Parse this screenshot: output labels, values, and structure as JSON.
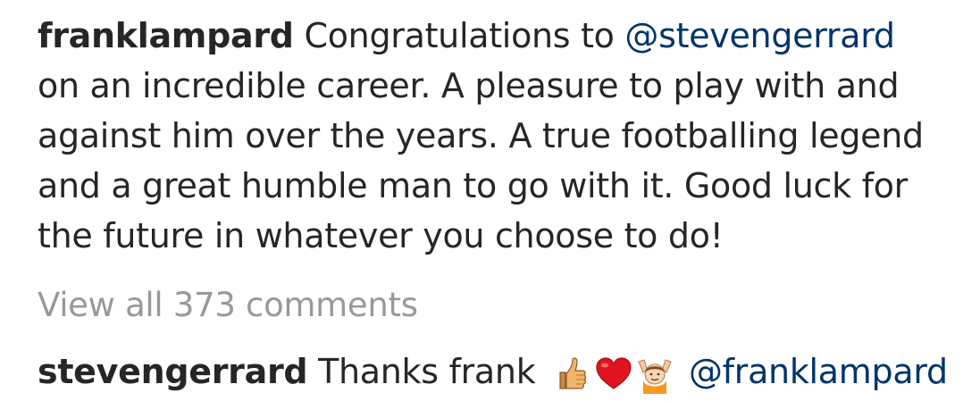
{
  "post": {
    "author": "franklampard",
    "caption_before_mention": "Congratulations to",
    "caption_mention": "@stevengerrard",
    "caption_after_mention": "on an incredible career. A pleasure to play with and against him over the years. A true footballing legend and a great humble man to go with it. Good luck for the future in whatever you choose to do!",
    "view_all_comments": "View all 373 comments"
  },
  "comment": {
    "author": "stevengerrard",
    "text": "Thanks frank",
    "emojis": [
      "thumbs-up-icon",
      "red-heart-icon",
      "person-raising-hands-icon"
    ],
    "mention": "@franklampard"
  },
  "colors": {
    "text": "#262626",
    "mention": "#003569",
    "muted": "#999999"
  }
}
